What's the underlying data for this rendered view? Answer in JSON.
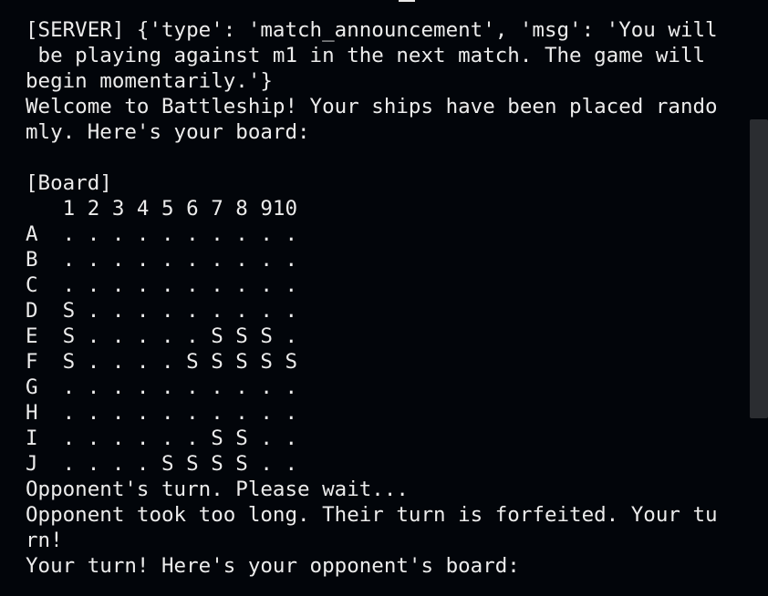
{
  "terminal": {
    "lines": [
      "[SERVER] {'type': 'match_announcement', 'msg': 'You will",
      " be playing against m1 in the next match. The game will",
      "begin momentarily.'}",
      "Welcome to Battleship! Your ships have been placed rando",
      "mly. Here's your board:",
      "",
      "[Board]",
      "   1 2 3 4 5 6 7 8 910",
      "A  . . . . . . . . . .",
      "B  . . . . . . . . . .",
      "C  . . . . . . . . . .",
      "D  S . . . . . . . . .",
      "E  S . . . . . S S S .",
      "F  S . . . . S S S S S",
      "G  . . . . . . . . . .",
      "H  . . . . . . . . . .",
      "I  . . . . . . S S . .",
      "J  . . . . S S S S . .",
      "Opponent's turn. Please wait...",
      "Opponent took too long. Their turn is forfeited. Your tu",
      "rn!",
      "Your turn! Here's your opponent's board:"
    ]
  }
}
